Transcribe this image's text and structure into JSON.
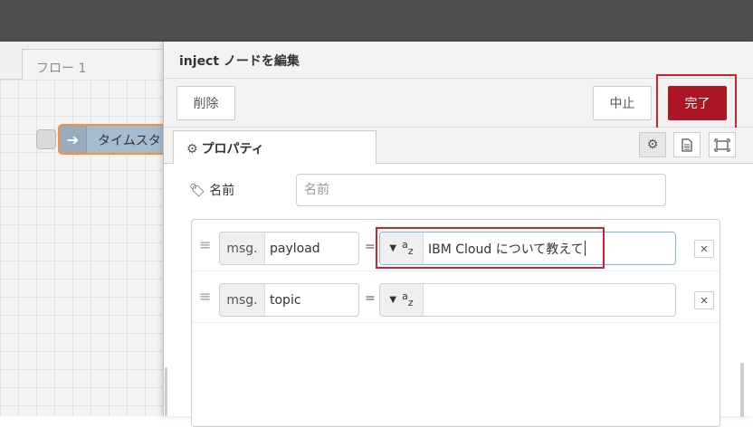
{
  "workspace": {
    "tab_label": "フロー 1",
    "node_label": "タイムスタンプ"
  },
  "tray": {
    "title": "inject ノードを編集",
    "delete_label": "削除",
    "cancel_label": "中止",
    "done_label": "完了",
    "tab_label": "プロパティ",
    "name_label": "名前",
    "name_placeholder": "名前"
  },
  "properties": [
    {
      "prefix": "msg.",
      "property": "payload",
      "type_icon": "string-az-icon",
      "value": "IBM Cloud について教えて"
    },
    {
      "prefix": "msg.",
      "property": "topic",
      "type_icon": "string-az-icon",
      "value": ""
    }
  ],
  "colors": {
    "done_button": "#ad1625",
    "highlight": "#d2202e",
    "node": "#a6bbcf",
    "node_border": "#ff8d33",
    "topbar": "#4f4f4f"
  }
}
